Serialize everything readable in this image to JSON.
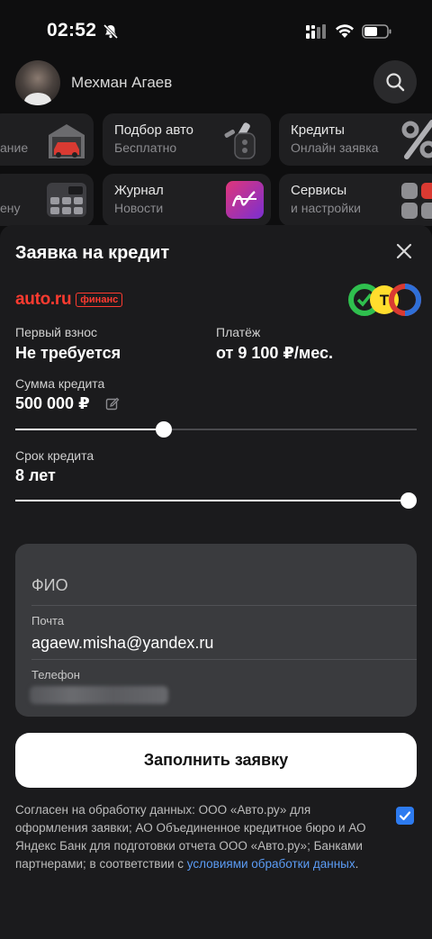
{
  "status_bar": {
    "time": "02:52"
  },
  "profile": {
    "name": "Мехман Агаев"
  },
  "tiles": {
    "partial_top": {
      "subtitle": "ание"
    },
    "podbor": {
      "title": "Подбор авто",
      "subtitle": "Бесплатно"
    },
    "credits": {
      "title": "Кредиты",
      "subtitle": "Онлайн заявка"
    },
    "partial_bottom": {
      "subtitle": "ену"
    },
    "journal": {
      "title": "Журнал",
      "subtitle": "Новости"
    },
    "services": {
      "title": "Сервисы",
      "subtitle": "и настройки"
    }
  },
  "sheet": {
    "title": "Заявка на кредит",
    "brand": {
      "name": "auto.ru",
      "badge": "финанс"
    },
    "bank_logo_text": "Т",
    "down_payment": {
      "label": "Первый взнос",
      "value": "Не требуется"
    },
    "payment": {
      "label": "Платёж",
      "value": "от 9 100 ₽/мес."
    },
    "amount": {
      "label": "Сумма кредита",
      "value": "500 000 ₽",
      "slider_fraction": 0.37
    },
    "term": {
      "label": "Срок кредита",
      "value": "8 лет",
      "slider_fraction": 1.0
    },
    "form": {
      "fio_placeholder": "ФИО",
      "email_label": "Почта",
      "email_value": "agaew.misha@yandex.ru",
      "phone_label": "Телефон"
    },
    "submit_label": "Заполнить заявку",
    "consent": {
      "text": "Согласен на обработку данных: ООО «Авто.ру» для оформления заявки; АО Объединенное кредитное бюро и АО Яндекс Банк для подготовки отчета ООО «Авто.ру»; Банками партнерами; в соответствии с ",
      "link": "условиями обработки данных",
      "tail": ".",
      "checked": true
    }
  },
  "colors": {
    "accent_red": "#ff3b30",
    "link_blue": "#5b9cf5",
    "checkbox_blue": "#2d7bf0"
  }
}
